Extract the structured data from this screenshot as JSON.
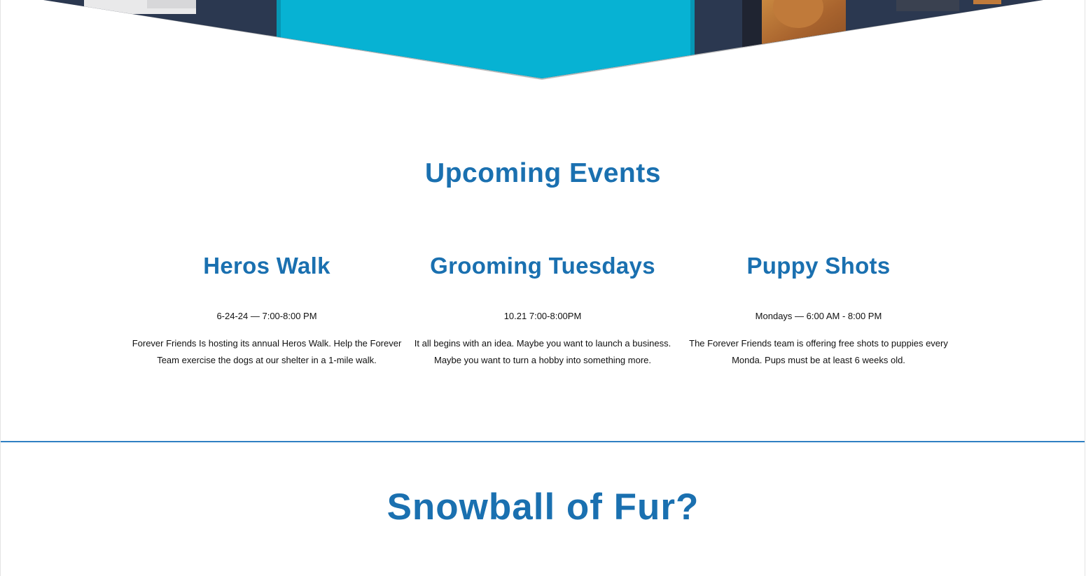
{
  "colors": {
    "brand_blue": "#1a70b0",
    "divider_blue": "#2f80c3",
    "hero_teal": "#07b2d3",
    "hero_navy": "#2b3850",
    "hero_dog_brown": "#b36f35"
  },
  "hero": {
    "image_name": "dogs-photo-banner"
  },
  "events_section": {
    "title": "Upcoming Events",
    "events": [
      {
        "title": "Heros Walk",
        "date": "6-24-24 — 7:00-8:00 PM",
        "description": "Forever Friends Is hosting its annual Heros Walk. Help the Forever Team exercise the dogs at our shelter in a 1-mile walk."
      },
      {
        "title": "Grooming Tuesdays",
        "date": "10.21  7:00-8:00PM",
        "description": "It all begins with an idea. Maybe you want to launch a business. Maybe you want to turn a hobby into something more."
      },
      {
        "title": "Puppy Shots",
        "date": "Mondays — 6:00 AM - 8:00 PM",
        "description": "The Forever Friends team is offering free shots to puppies every Monda. Pups must be at least 6 weeks old."
      }
    ]
  },
  "snowball_section": {
    "title": "Snowball of Fur?"
  }
}
